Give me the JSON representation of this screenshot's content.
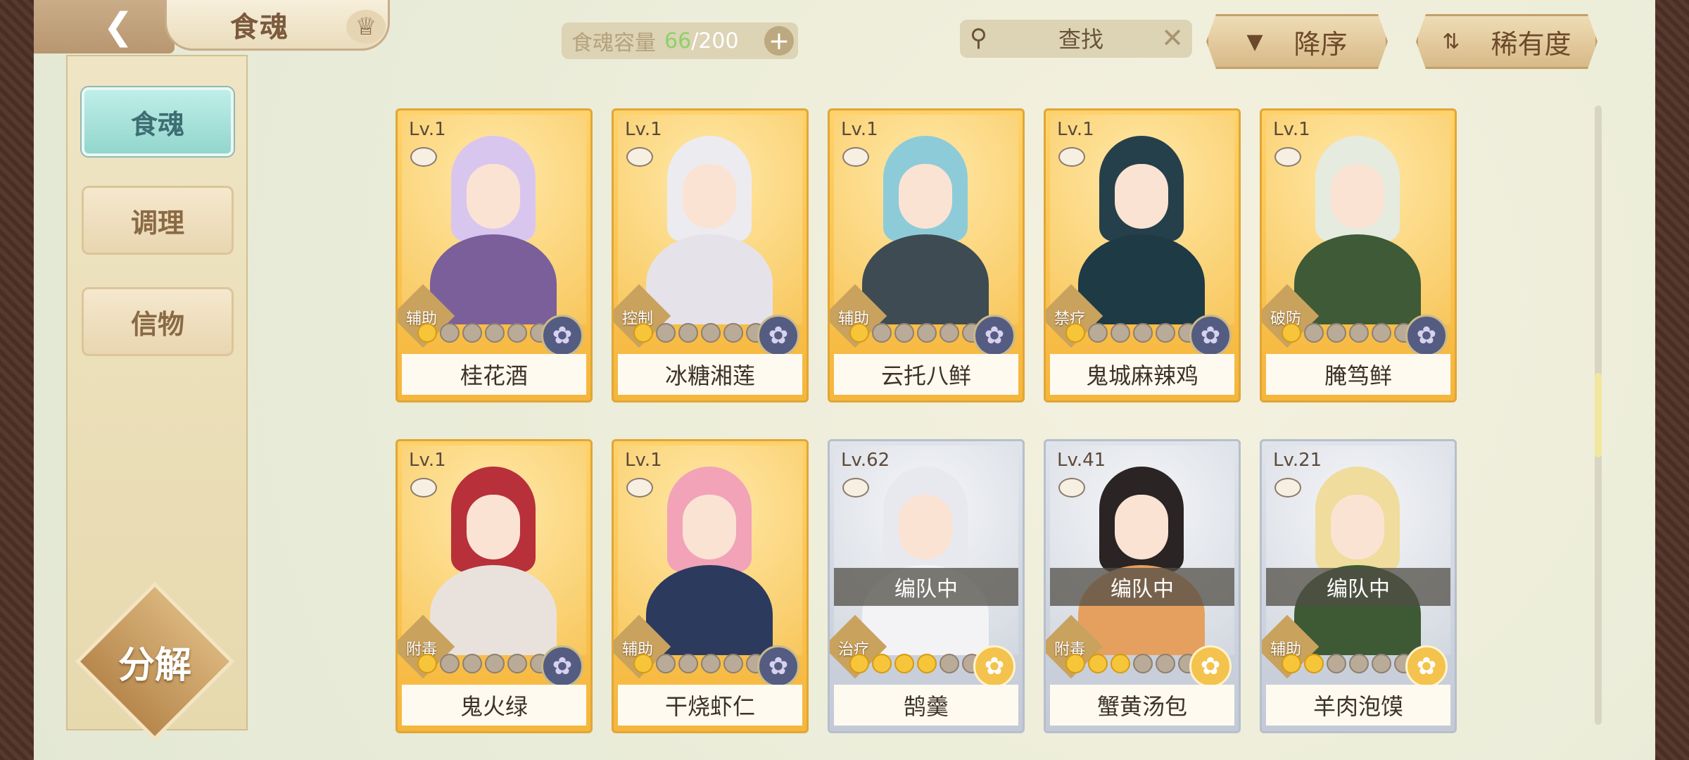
{
  "header": {
    "title": "食魂",
    "capacity_label": "食魂容量",
    "capacity_current": "66",
    "capacity_sep": "/",
    "capacity_max": "200",
    "search_placeholder": "查找",
    "sort_order_label": "降序",
    "sort_key_label": "稀有度"
  },
  "sidebar": {
    "items": [
      {
        "label": "食魂",
        "active": true
      },
      {
        "label": "调理",
        "active": false
      },
      {
        "label": "信物",
        "active": false
      }
    ],
    "decompose_label": "分解"
  },
  "cards": [
    {
      "level": "Lv.1",
      "name": "桂花酒",
      "role": "辅助",
      "stars": 1,
      "rarity": "gold",
      "flower": "dark",
      "team_status": "",
      "hair": "#d9c6ef",
      "body": "#7a5f9a"
    },
    {
      "level": "Lv.1",
      "name": "冰糖湘莲",
      "role": "控制",
      "stars": 1,
      "rarity": "gold",
      "flower": "dark",
      "team_status": "",
      "hair": "#ecebf0",
      "body": "#e5e2ea"
    },
    {
      "level": "Lv.1",
      "name": "云托八鲜",
      "role": "辅助",
      "stars": 1,
      "rarity": "gold",
      "flower": "dark",
      "team_status": "",
      "hair": "#8ecbd8",
      "body": "#3e4b52"
    },
    {
      "level": "Lv.1",
      "name": "鬼城麻辣鸡",
      "role": "禁疗",
      "stars": 1,
      "rarity": "gold",
      "flower": "dark",
      "team_status": "",
      "hair": "#25404a",
      "body": "#1e3a44"
    },
    {
      "level": "Lv.1",
      "name": "腌笃鲜",
      "role": "破防",
      "stars": 1,
      "rarity": "gold",
      "flower": "dark",
      "team_status": "",
      "hair": "#e6ebe0",
      "body": "#3f5a36"
    },
    {
      "level": "Lv.1",
      "name": "鬼火绿",
      "role": "附毒",
      "stars": 1,
      "rarity": "gold",
      "flower": "dark",
      "team_status": "",
      "hair": "#b8303a",
      "body": "#e9e2dc"
    },
    {
      "level": "Lv.1",
      "name": "干烧虾仁",
      "role": "辅助",
      "stars": 1,
      "rarity": "gold",
      "flower": "dark",
      "team_status": "",
      "hair": "#f2a3b8",
      "body": "#2c3a5e"
    },
    {
      "level": "Lv.62",
      "name": "鹄羹",
      "role": "治疗",
      "stars": 4,
      "rarity": "silver",
      "flower": "gold",
      "team_status": "编队中",
      "hair": "#e8e8ef",
      "body": "#f3f3f6"
    },
    {
      "level": "Lv.41",
      "name": "蟹黄汤包",
      "role": "附毒",
      "stars": 3,
      "rarity": "silver",
      "flower": "gold",
      "team_status": "编队中",
      "hair": "#2a2424",
      "body": "#e5a060"
    },
    {
      "level": "Lv.21",
      "name": "羊肉泡馍",
      "role": "辅助",
      "stars": 2,
      "rarity": "silver",
      "flower": "gold",
      "team_status": "编队中",
      "hair": "#f0dc9c",
      "body": "#3d5a35"
    }
  ],
  "icons": {
    "back": "back-arrow-icon",
    "crown": "crown-icon",
    "plus": "plus-icon",
    "search": "search-icon",
    "clear": "close-icon",
    "sort_order": "triangle-down-icon",
    "sort_key": "sort-arrows-icon",
    "flower": "chrysanthemum-icon"
  }
}
